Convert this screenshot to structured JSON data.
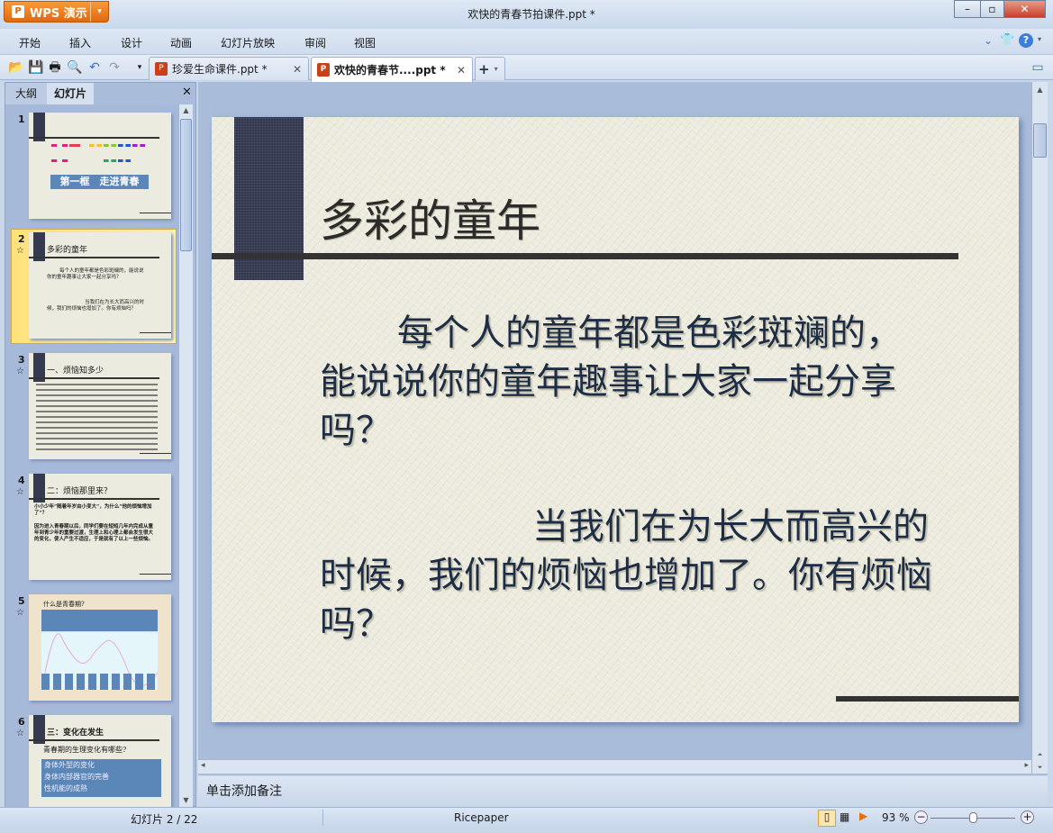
{
  "window": {
    "app_button": "WPS 演示",
    "title": "欢快的青春节拍课件.ppt *"
  },
  "menu": [
    "开始",
    "插入",
    "设计",
    "动画",
    "幻灯片放映",
    "审阅",
    "视图"
  ],
  "tabs": [
    {
      "label": "珍爱生命课件.ppt *",
      "active": false
    },
    {
      "label": "欢快的青春节....ppt *",
      "active": true
    }
  ],
  "panel": {
    "tabs": [
      "大纲",
      "幻灯片"
    ],
    "active_tab": "幻灯片"
  },
  "thumbnails": [
    {
      "num": "1",
      "title": "",
      "subtitle": "第一框　走进青春",
      "rainbow_title_colors": [
        "#e0207a",
        "#f2c12e",
        "#27a36b",
        "#2255d6",
        "#9a22c8"
      ]
    },
    {
      "num": "2",
      "title": "多彩的童年",
      "body": [
        "每个人的童年都是色彩斑斓的，能说说你的童年趣事让大家一起分享吗？",
        "当我们在为长大而高兴的时候，我们的烦恼也增加了。你有烦恼吗？"
      ]
    },
    {
      "num": "3",
      "title": "一、烦恼知多少"
    },
    {
      "num": "4",
      "title": "二：烦恼那里来？",
      "body": [
        "小小少年“随着年岁由小变大”，为什么“他的烦恼增加了”？",
        "因为进入青春期以后，同学们要在短短几年内完成从童年到青少年的重要过渡，生理上和心理上都会发生很大的变化，使人产生不适应，于是就有了以上一些烦恼。"
      ]
    },
    {
      "num": "5",
      "title": "什么是青春期?"
    },
    {
      "num": "6",
      "title": "三：变化在发生",
      "body": [
        "青春期的生理变化有哪些?",
        "身体外型的变化",
        "身体内部器官的完善",
        "性机能的成熟"
      ]
    }
  ],
  "slide": {
    "title": "多彩的童年",
    "para1": "每个人的童年都是色彩斑斓的，能说说你的童年趣事让大家一起分享吗？",
    "para2": "当我们在为长大而高兴的时候，我们的烦恼也增加了。你有烦恼吗？"
  },
  "notes_placeholder": "单击添加备注",
  "status": {
    "slide_info": "幻灯片 2 / 22",
    "theme": "Ricepaper",
    "zoom": "93 %",
    "zoom_slider_fraction": 0.5
  },
  "colors": {
    "accent": "#e2680e",
    "selected_thumb": "#ffe27a"
  }
}
